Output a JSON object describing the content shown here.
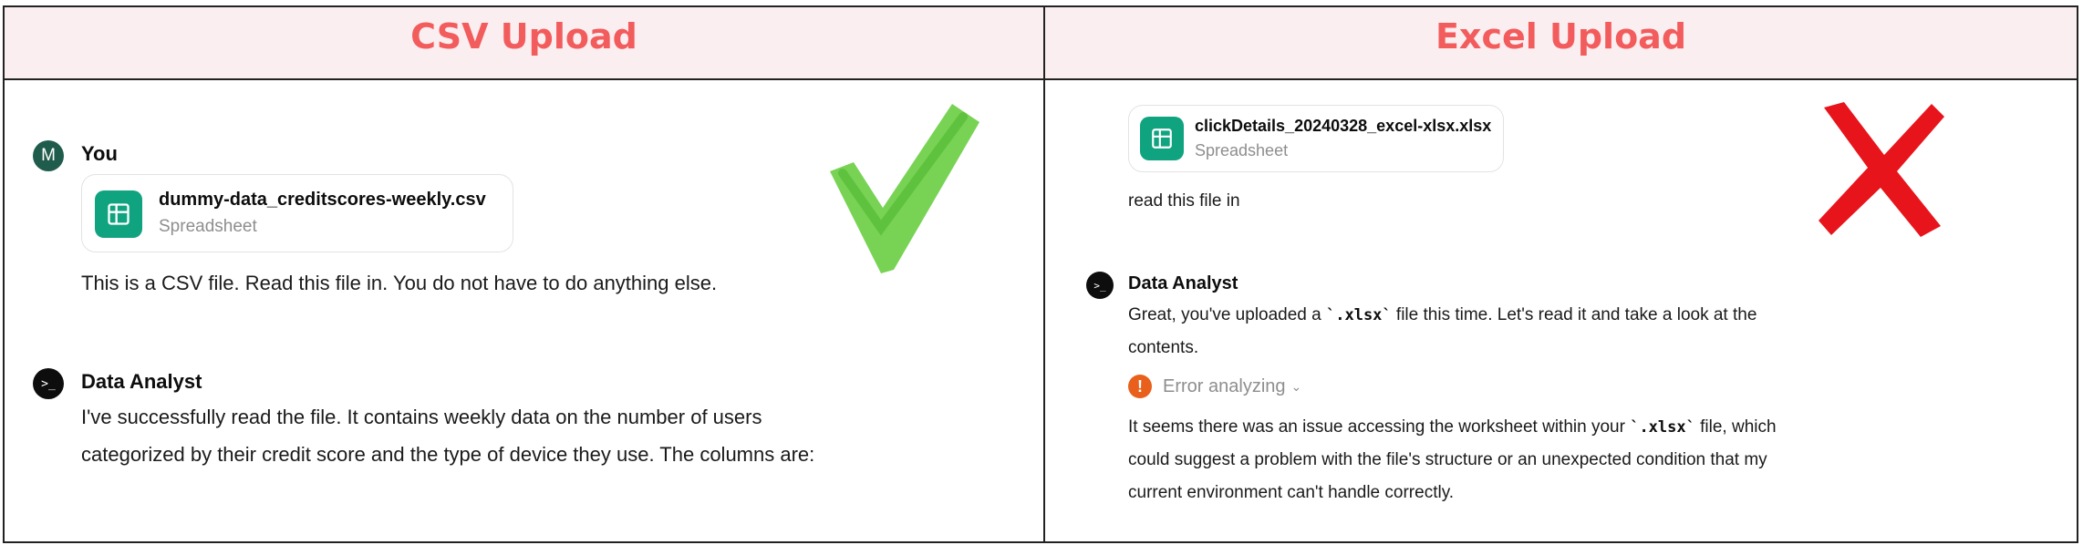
{
  "headers": {
    "left": "CSV Upload",
    "right": "Excel Upload"
  },
  "left_panel": {
    "user": {
      "avatar_letter": "M",
      "author": "You"
    },
    "file": {
      "name": "dummy-data_creditscores-weekly.csv",
      "type": "Spreadsheet",
      "icon": "spreadsheet-icon"
    },
    "user_message": "This is a CSV file. Read this file in. You do not have to do anything else.",
    "bot": {
      "avatar_glyph": ">_",
      "author": "Data Analyst"
    },
    "bot_message_line1": "I've successfully read the file. It contains weekly data on the number of users",
    "bot_message_line2": "categorized by their credit score and the type of device they use. The columns are:",
    "status_mark": {
      "icon": "checkmark-icon",
      "color": "#6ccf47"
    }
  },
  "right_panel": {
    "file": {
      "name": "clickDetails_20240328_excel-xlsx.xlsx",
      "type": "Spreadsheet",
      "icon": "spreadsheet-icon"
    },
    "user_message": "read this file in",
    "bot": {
      "avatar_glyph": ">_",
      "author": "Data Analyst"
    },
    "bot_message_part1": "Great, you've uploaded a ",
    "bot_message_code": "`.xlsx`",
    "bot_message_part2": " file this time. Let's read it and take a look at the",
    "bot_message_line2": "contents.",
    "error": {
      "label": "Error analyzing",
      "badge": "!",
      "color": "#e8601c"
    },
    "error_msg_part1": "It seems there was an issue accessing the worksheet within your ",
    "error_msg_code": "`.xlsx`",
    "error_msg_part2": " file, which",
    "error_msg_line2": "could suggest a problem with the file's structure or an unexpected condition that my",
    "error_msg_line3": "current environment can't handle correctly.",
    "status_mark": {
      "icon": "cross-icon",
      "color": "#e8141b"
    }
  }
}
